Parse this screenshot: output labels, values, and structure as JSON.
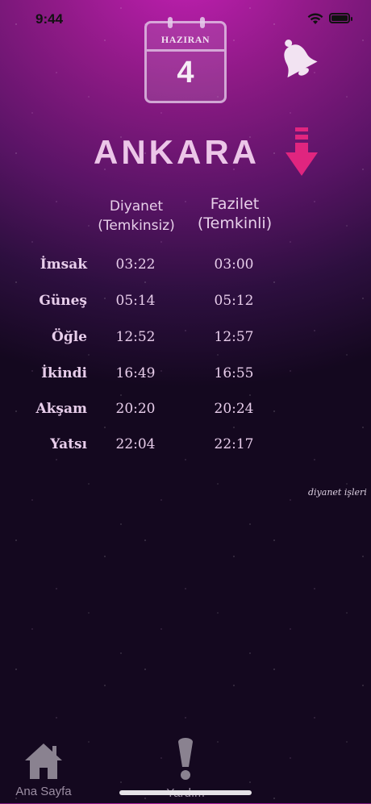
{
  "status_bar": {
    "time": "9:44",
    "icons": [
      "wifi-icon",
      "battery-icon"
    ]
  },
  "calendar": {
    "month": "HAZIRAN",
    "day": "4"
  },
  "icons": {
    "calendar": "calendar-icon",
    "bell": "bell-icon",
    "city_picker": "arrow-down-icon",
    "home": "home-icon",
    "help": "exclamation-icon"
  },
  "city": "ANKARA",
  "columns": {
    "diyanet_line1": "Diyanet",
    "diyanet_line2": "(Temkinsiz)",
    "fazilet_line1": "Fazilet",
    "fazilet_line2": "(Temkinli)"
  },
  "prayers": [
    {
      "name": "İmsak",
      "diyanet": "03:22",
      "fazilet": "03:00"
    },
    {
      "name": "Güneş",
      "diyanet": "05:14",
      "fazilet": "05:12"
    },
    {
      "name": "Öğle",
      "diyanet": "12:52",
      "fazilet": "12:57"
    },
    {
      "name": "İkindi",
      "diyanet": "16:49",
      "fazilet": "16:55"
    },
    {
      "name": "Akşam",
      "diyanet": "20:20",
      "fazilet": "20:24"
    },
    {
      "name": "Yatsı",
      "diyanet": "22:04",
      "fazilet": "22:17"
    }
  ],
  "note": "diyanet işleri",
  "tab_bar": {
    "home_label": "Ana Sayfa",
    "help_label": "Yardım"
  },
  "colors": {
    "accent_pink": "#e0257f",
    "text": "#e7cdea",
    "tab_label": "#9c8ea3"
  }
}
